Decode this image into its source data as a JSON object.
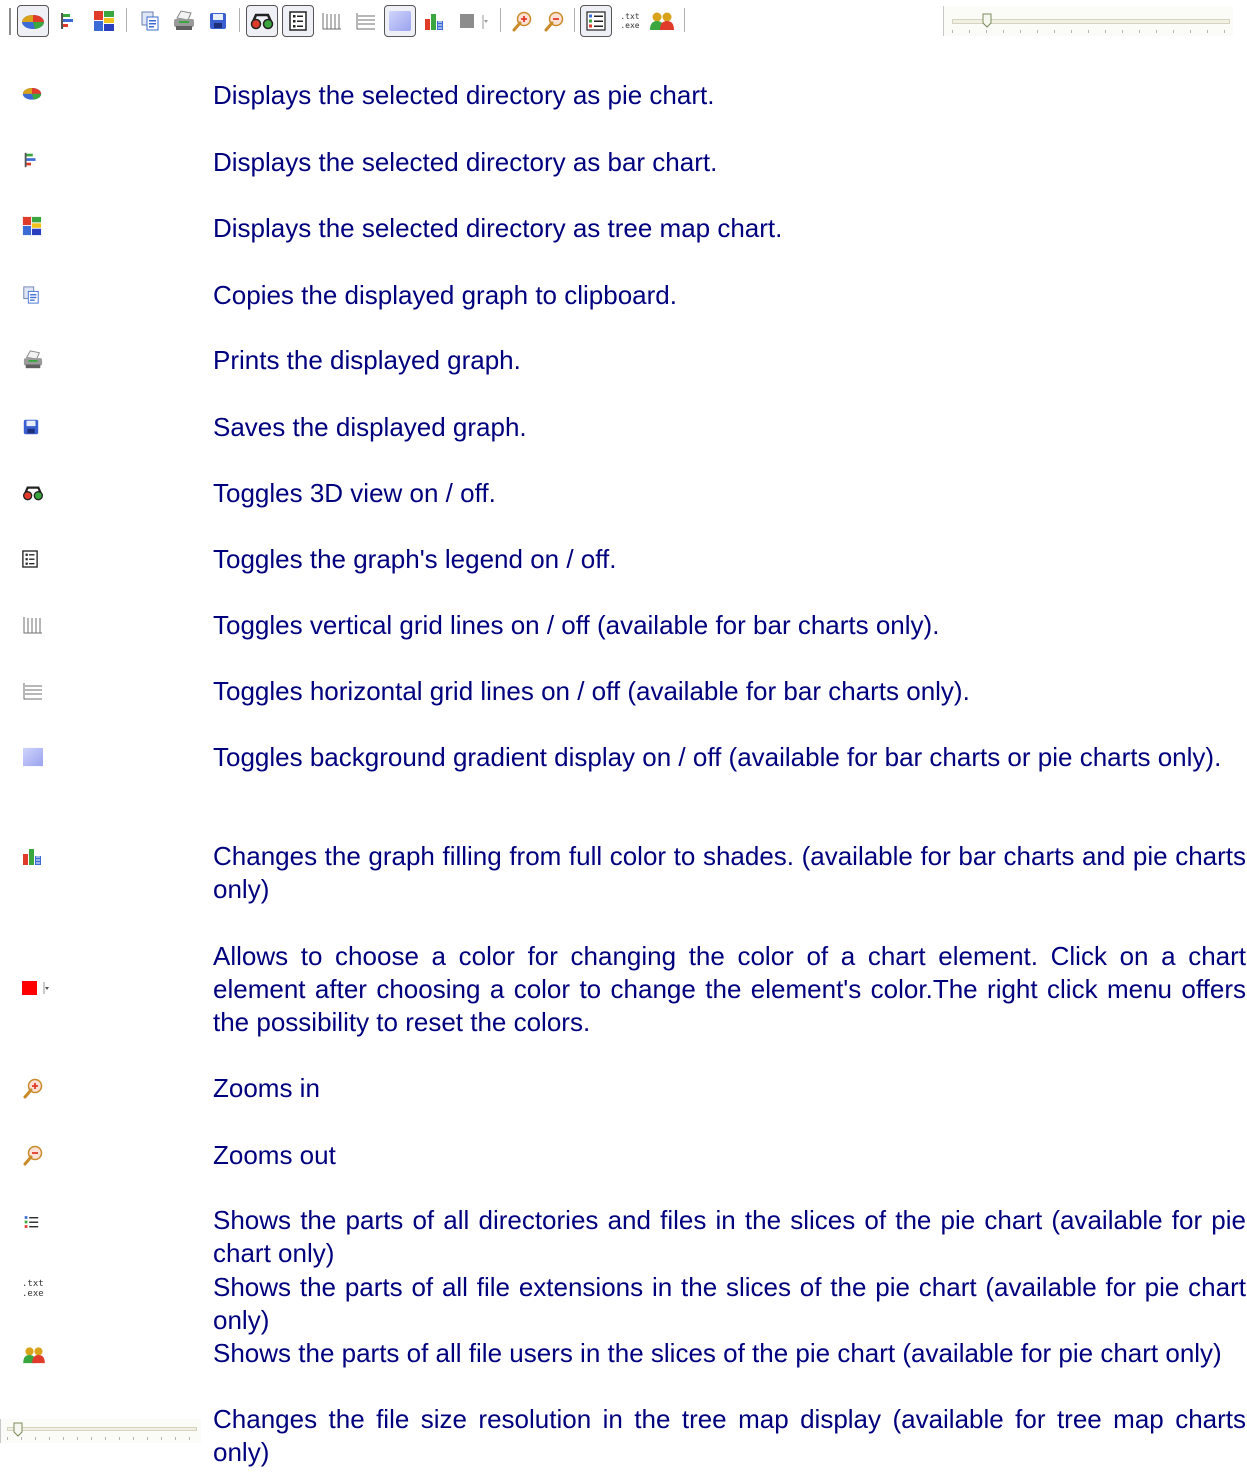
{
  "toolbar": {
    "buttons": [
      {
        "icon": "pie-chart-icon",
        "state": "pressed"
      },
      {
        "icon": "bar-chart-icon"
      },
      {
        "icon": "tree-map-icon"
      },
      {
        "icon": "copy-icon"
      },
      {
        "icon": "print-icon"
      },
      {
        "icon": "save-icon"
      },
      {
        "icon": "3d-view-icon",
        "state": "pressed"
      },
      {
        "icon": "legend-icon",
        "state": "pressed"
      },
      {
        "icon": "vertical-grid-icon"
      },
      {
        "icon": "horizontal-grid-icon"
      },
      {
        "icon": "background-gradient-icon",
        "state": "pressed"
      },
      {
        "icon": "shades-fill-icon"
      },
      {
        "icon": "color-picker-icon"
      },
      {
        "icon": "zoom-in-icon"
      },
      {
        "icon": "zoom-out-icon"
      },
      {
        "icon": "directories-files-icon",
        "state": "pressed"
      },
      {
        "icon": "file-extensions-icon"
      },
      {
        "icon": "file-users-icon"
      },
      {
        "icon": "resolution-slider"
      }
    ],
    "ext_icon_line1": ".txt",
    "ext_icon_line2": ".exe"
  },
  "items": [
    {
      "icon": "pie-chart-icon",
      "text": "Displays the selected directory as pie chart."
    },
    {
      "icon": "bar-chart-icon",
      "text": "Displays the selected directory as bar chart."
    },
    {
      "icon": "tree-map-icon",
      "text": "Displays the selected directory as tree map chart."
    },
    {
      "icon": "copy-icon",
      "text": "Copies the displayed graph to clipboard."
    },
    {
      "icon": "print-icon",
      "text": "Prints the displayed graph."
    },
    {
      "icon": "save-icon",
      "text": "Saves the displayed graph."
    },
    {
      "icon": "3d-view-icon",
      "text": "Toggles 3D view on / off."
    },
    {
      "icon": "legend-icon",
      "text": "Toggles the graph's legend on / off."
    },
    {
      "icon": "vertical-grid-icon",
      "text": "Toggles vertical grid lines on / off (available for bar charts only)."
    },
    {
      "icon": "horizontal-grid-icon",
      "text": "Toggles horizontal grid lines on / off (available for bar charts only)."
    },
    {
      "icon": "background-gradient-icon",
      "text": "Toggles background gradient display on / off (available for bar charts or pie charts only)."
    },
    {
      "icon": "shades-fill-icon",
      "text": "Changes the graph filling from full color to shades. (available for bar charts and pie charts only)"
    },
    {
      "icon": "color-picker-icon",
      "text": "Allows to choose a color for changing the color of a chart element. Click on a chart element after choosing a color to change the element's color.The right click menu offers the possibility to reset the colors."
    },
    {
      "icon": "zoom-in-icon",
      "text": "Zooms in"
    },
    {
      "icon": "zoom-out-icon",
      "text": "Zooms out"
    },
    {
      "icon": "directories-files-icon",
      "text": "Shows the parts of all directories and files in the slices of the pie chart (available for pie chart only)"
    },
    {
      "icon": "file-extensions-icon",
      "text": "Shows the parts of all file extensions in the slices of the pie chart (available for pie chart only)"
    },
    {
      "icon": "file-users-icon",
      "text": "Shows the parts of all file users in the slices of the pie chart (available for pie chart only)"
    },
    {
      "icon": "resolution-slider",
      "text": "Changes the file size resolution in the tree map display (available for tree map charts only)"
    }
  ],
  "colors": {
    "text": "#00007f",
    "accent_red": "#ff0000",
    "accent_blue": "#3a5fd0"
  }
}
